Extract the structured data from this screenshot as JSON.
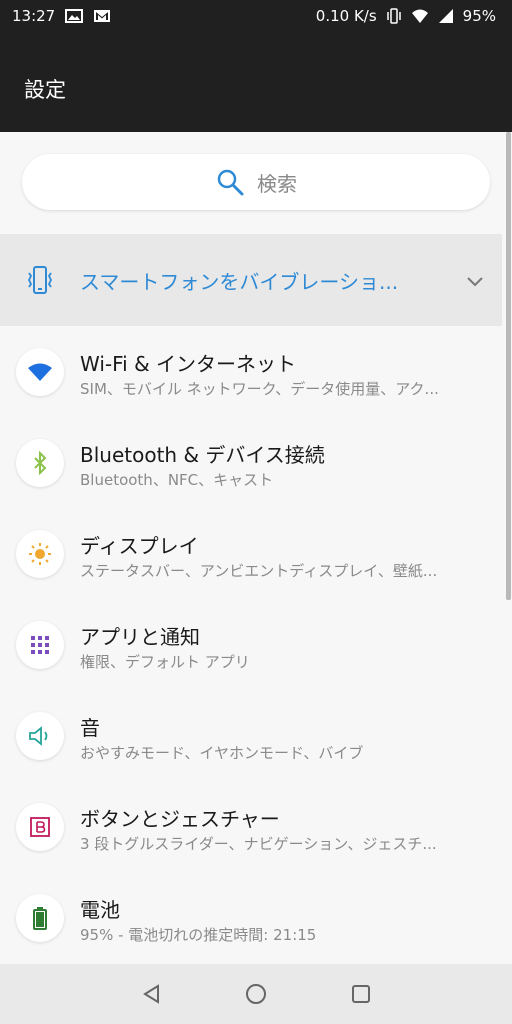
{
  "status_bar": {
    "time": "13:27",
    "net_speed": "0.10 K/s",
    "battery": "95%",
    "icons": [
      "image-icon",
      "gmail-icon",
      "vibrate-icon",
      "wifi-icon",
      "signal-icon",
      "battery-icon"
    ]
  },
  "app_bar": {
    "title": "設定"
  },
  "search": {
    "placeholder": "検索"
  },
  "vibration_banner": {
    "text": "スマートフォンをバイブレーショ..."
  },
  "settings": [
    {
      "title": "Wi-Fi & インターネット",
      "subtitle": "SIM、モバイル ネットワーク、データ使用量、アク...",
      "icon": "wifi-icon",
      "color": "#1e6fe0"
    },
    {
      "title": "Bluetooth & デバイス接続",
      "subtitle": "Bluetooth、NFC、キャスト",
      "icon": "bluetooth-icon",
      "color": "#8bc34a"
    },
    {
      "title": "ディスプレイ",
      "subtitle": "ステータスバー、アンビエントディスプレイ、壁紙...",
      "icon": "brightness-icon",
      "color": "#f0a830"
    },
    {
      "title": "アプリと通知",
      "subtitle": "権限、デフォルト アプリ",
      "icon": "apps-grid-icon",
      "color": "#7c4dbd"
    },
    {
      "title": "音",
      "subtitle": "おやすみモード、イヤホンモード、バイブ",
      "icon": "volume-icon",
      "color": "#26a69a"
    },
    {
      "title": "ボタンとジェスチャー",
      "subtitle": "3 段トグルスライダー、ナビゲーション、ジェスチ...",
      "icon": "buttons-icon",
      "color": "#c2185b"
    },
    {
      "title": "電池",
      "subtitle": "95% - 電池切れの推定時間: 21:15",
      "icon": "battery-icon",
      "color": "#2e7d32"
    }
  ],
  "nav_bar": {
    "buttons": [
      "back-icon",
      "home-icon",
      "recents-icon"
    ]
  }
}
